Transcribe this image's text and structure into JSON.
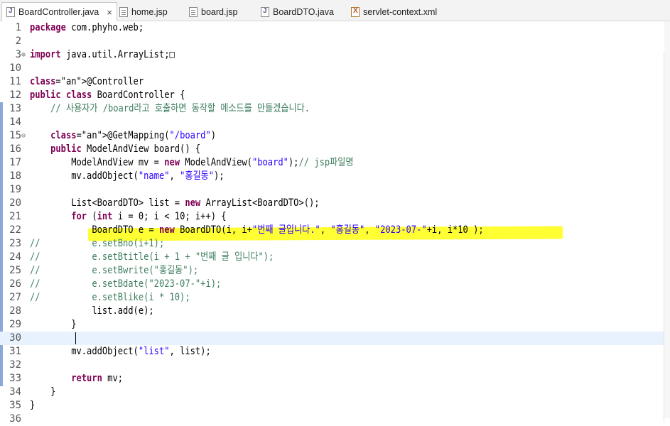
{
  "tabs": [
    {
      "label": "BoardController.java",
      "icon": "java-file-icon",
      "active": true,
      "close": "×"
    },
    {
      "label": "home.jsp",
      "icon": "jsp-file-icon",
      "active": false
    },
    {
      "label": "board.jsp",
      "icon": "jsp-file-icon",
      "active": false
    },
    {
      "label": "BoardDTO.java",
      "icon": "java-file-icon",
      "active": false
    },
    {
      "label": "servlet-context.xml",
      "icon": "xml-file-icon",
      "active": false
    }
  ],
  "editor": {
    "highlight_color": "#ffff33",
    "current_line": 30,
    "lines": [
      {
        "n": "1",
        "text": "package com.phyho.web;"
      },
      {
        "n": "2",
        "text": ""
      },
      {
        "n": "3",
        "text": "import java.util.ArrayList;□",
        "fold": "⊕"
      },
      {
        "n": "10",
        "text": ""
      },
      {
        "n": "11",
        "text": "@Controller"
      },
      {
        "n": "12",
        "text": "public class BoardController {"
      },
      {
        "n": "13",
        "text": "    // 사용자가 /board라고 호출하면 동작할 메소드를 만들겠습니다."
      },
      {
        "n": "14",
        "text": ""
      },
      {
        "n": "15",
        "text": "    @GetMapping(\"/board\")",
        "fold": "⊖"
      },
      {
        "n": "16",
        "text": "    public ModelAndView board() {"
      },
      {
        "n": "17",
        "text": "        ModelAndView mv = new ModelAndView(\"board\");// jsp파일명"
      },
      {
        "n": "18",
        "text": "        mv.addObject(\"name\", \"홍길동\");"
      },
      {
        "n": "19",
        "text": ""
      },
      {
        "n": "20",
        "text": "        List<BoardDTO> list = new ArrayList<BoardDTO>();"
      },
      {
        "n": "21",
        "text": "        for (int i = 0; i < 10; i++) {"
      },
      {
        "n": "22",
        "text": "            BoardDTO e = new BoardDTO(i, i+\"번째 글입니다.\", \"홍길동\", \"2023-07-\"+i, i*10 );"
      },
      {
        "n": "23",
        "text": "//          e.setBno(i+1);"
      },
      {
        "n": "24",
        "text": "//          e.setBtitle(i + 1 + \"번째 글 입니다\");"
      },
      {
        "n": "25",
        "text": "//          e.setBwrite(\"홍길동\");"
      },
      {
        "n": "26",
        "text": "//          e.setBdate(\"2023-07-\"+i);"
      },
      {
        "n": "27",
        "text": "//          e.setBlike(i * 10);"
      },
      {
        "n": "28",
        "text": "            list.add(e);"
      },
      {
        "n": "29",
        "text": "        }"
      },
      {
        "n": "30",
        "text": ""
      },
      {
        "n": "31",
        "text": "        mv.addObject(\"list\", list);"
      },
      {
        "n": "32",
        "text": ""
      },
      {
        "n": "33",
        "text": "        return mv;"
      },
      {
        "n": "34",
        "text": "    }"
      },
      {
        "n": "35",
        "text": "}"
      },
      {
        "n": "36",
        "text": ""
      }
    ]
  }
}
